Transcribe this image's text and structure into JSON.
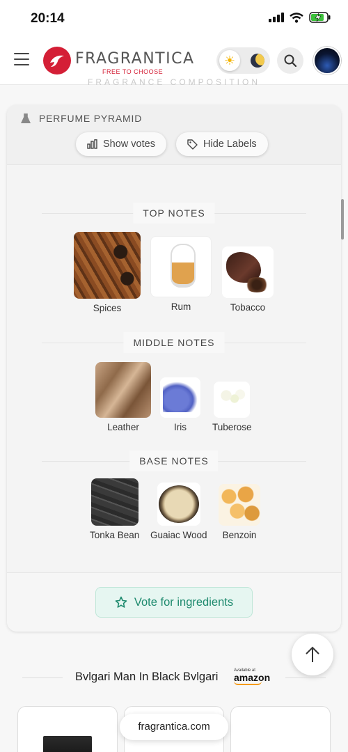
{
  "status_bar": {
    "time": "20:14"
  },
  "header": {
    "logo_text": "FRAGRANTICA",
    "logo_tagline": "FREE TO CHOOSE",
    "faded_heading": "FRAGRANCE COMPOSITION"
  },
  "pyramid": {
    "title": "PERFUME PYRAMID",
    "show_votes_label": "Show votes",
    "hide_labels_label": "Hide Labels",
    "sections": [
      {
        "label": "TOP NOTES",
        "notes": [
          {
            "name": "Spices"
          },
          {
            "name": "Rum"
          },
          {
            "name": "Tobacco"
          }
        ]
      },
      {
        "label": "MIDDLE NOTES",
        "notes": [
          {
            "name": "Leather"
          },
          {
            "name": "Iris"
          },
          {
            "name": "Tuberose"
          }
        ]
      },
      {
        "label": "BASE NOTES",
        "notes": [
          {
            "name": "Tonka Bean"
          },
          {
            "name": "Guaiac Wood"
          },
          {
            "name": "Benzoin"
          }
        ]
      }
    ],
    "vote_button_label": "Vote for ingredients"
  },
  "amazon": {
    "title": "Bvlgari Man In Black Bvlgari",
    "available_at": "Available at",
    "logo": "amazon"
  },
  "footer": {
    "domain": "fragrantica.com"
  },
  "colors": {
    "brand_red": "#d41f36",
    "vote_green": "#1e8a6e",
    "vote_bg": "#e6f6f1"
  }
}
